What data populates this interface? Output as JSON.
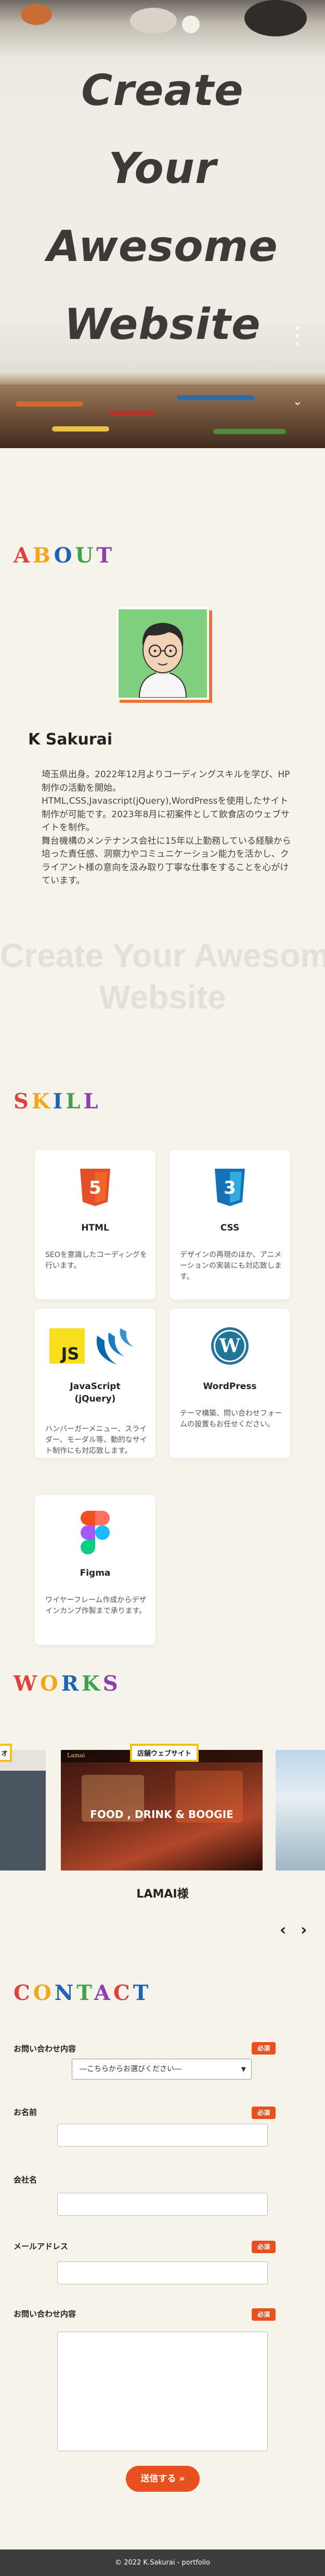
{
  "hero": {
    "title_lines": [
      "Create",
      "Your",
      "Awesome",
      "Website"
    ]
  },
  "about": {
    "title_letters": [
      "A",
      "B",
      "O",
      "U",
      "T"
    ],
    "name": "K Sakurai",
    "bio": [
      "埼玉県出身。2022年12月よりコーディングスキルを学び、HP制作の活動を開始。",
      "HTML,CSS,Javascript(jQuery),WordPressを使用したサイト制作が可能です。2023年8月に初案件として飲食店のウェブサイトを制作。",
      "舞台機構のメンテナンス会社に15年以上勤務している経験から培った責任感、洞察力やコミュニケーション能力を活かし、クライアント様の意向を汲み取り丁寧な仕事をすることを心がけています。"
    ],
    "watermark_lines": [
      "Create Your Awesome",
      "Website"
    ]
  },
  "skill": {
    "title_letters": [
      "S",
      "K",
      "I",
      "L",
      "L"
    ],
    "cards": [
      {
        "name": "HTML",
        "desc": "SEOを意識したコーディングを行います。",
        "icons": [
          "html5-icon"
        ]
      },
      {
        "name": "CSS",
        "desc": "デザインの再現のほか、アニメーションの実装にも対応致します。",
        "icons": [
          "css3-icon"
        ]
      },
      {
        "name": "JavaScript\n(jQuery)",
        "desc": "ハンバーガーメニュー、スライダー、モーダル等、動的なサイト制作にも対応致します。",
        "icons": [
          "javascript-icon",
          "jquery-icon"
        ]
      },
      {
        "name": "WordPress",
        "desc": "テーマ構築、問い合わせフォームの設置もお任せください。",
        "icons": [
          "wordpress-icon"
        ]
      },
      {
        "name": "Figma",
        "desc": "ワイヤーフレーム作成からデザインカンプ作製まで承ります。",
        "icons": [
          "figma-icon"
        ]
      }
    ]
  },
  "works": {
    "title_letters": [
      "W",
      "O",
      "R",
      "K",
      "S"
    ],
    "tag_main": "店舗ウェブサイト",
    "tag_left": "オ",
    "slide_headline": "FOOD , DRINK & BOOGIE",
    "slide_brand": "Lamai",
    "caption": "LAMAI様",
    "prev": "‹",
    "next": "›"
  },
  "contact": {
    "title_letters": [
      "C",
      "O",
      "N",
      "T",
      "A",
      "C",
      "T"
    ],
    "required_label": "必須",
    "fields": {
      "inquiry_type": "お問い合わせ内容",
      "inquiry_placeholder": "―こちらからお選びください―",
      "name": "お名前",
      "company": "会社名",
      "email": "メールアドレス",
      "message": "お問い合わせ内容"
    },
    "submit": "送信する"
  },
  "footer": {
    "copyright": "© 2022 K.Sakurai - portfolio"
  },
  "colors": {
    "accent": "#e9501f",
    "background": "#f6f3ea",
    "footer": "#3d3d3d",
    "works_tag_border": "#f2c20e"
  }
}
